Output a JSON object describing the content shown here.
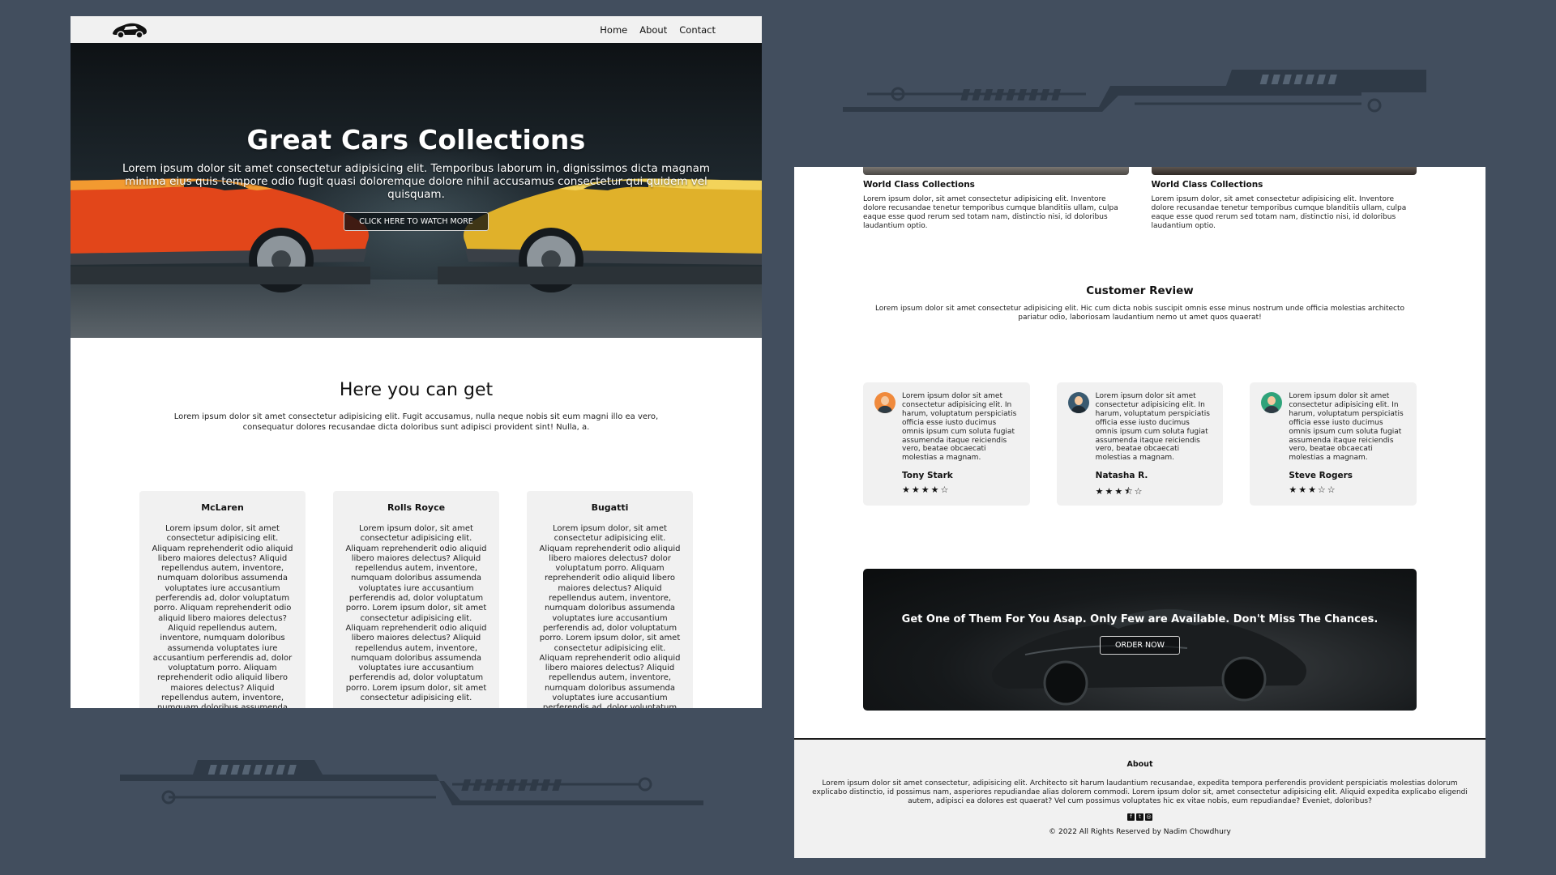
{
  "nav": {
    "links": [
      "Home",
      "About",
      "Contact"
    ]
  },
  "hero": {
    "title": "Great Cars Collections",
    "text": "Lorem ipsum dolor sit amet consectetur adipisicing elit. Temporibus laborum in, dignissimos dicta magnam minima eius quis tempore odio fugit quasi doloremque dolore nihil accusamus consectetur qui quidem vel quisquam.",
    "button": "CLICK HERE TO WATCH MORE"
  },
  "get": {
    "title": "Here you can get",
    "text": "Lorem ipsum dolor sit amet consectetur adipisicing elit. Fugit accusamus, nulla neque nobis sit eum magni illo ea vero, consequatur dolores recusandae dicta doloribus sunt adipisci provident sint! Nulla, a."
  },
  "brands": [
    {
      "name": "McLaren",
      "text": "Lorem ipsum dolor, sit amet consectetur adipisicing elit. Aliquam reprehenderit odio aliquid libero maiores delectus? Aliquid repellendus autem, inventore, numquam doloribus assumenda voluptates iure accusantium perferendis ad, dolor voluptatum porro. Aliquam reprehenderit odio aliquid libero maiores delectus? Aliquid repellendus autem, inventore, numquam doloribus assumenda voluptates iure accusantium perferendis ad, dolor voluptatum porro. Aliquam reprehenderit odio aliquid libero maiores delectus? Aliquid repellendus autem, inventore, numquam doloribus assumenda voluptates iure accusantium perferendis ad, dolor"
    },
    {
      "name": "Rolls Royce",
      "text": "Lorem ipsum dolor, sit amet consectetur adipisicing elit. Aliquam reprehenderit odio aliquid libero maiores delectus? Aliquid repellendus autem, inventore, numquam doloribus assumenda voluptates iure accusantium perferendis ad, dolor voluptatum porro. Lorem ipsum dolor, sit amet consectetur adipisicing elit. Aliquam reprehenderit odio aliquid libero maiores delectus? Aliquid repellendus autem, inventore, numquam doloribus assumenda voluptates iure accusantium perferendis ad, dolor voluptatum porro. Lorem ipsum dolor, sit amet consectetur adipisicing elit."
    },
    {
      "name": "Bugatti",
      "text": "Lorem ipsum dolor, sit amet consectetur adipisicing elit. Aliquam reprehenderit odio aliquid libero maiores delectus? dolor voluptatum porro. Aliquam reprehenderit odio aliquid libero maiores delectus? Aliquid repellendus autem, inventore, numquam doloribus assumenda voluptates iure accusantium perferendis ad, dolor voluptatum porro. Lorem ipsum dolor, sit amet consectetur adipisicing elit. Aliquam reprehenderit odio aliquid libero maiores delectus? Aliquid repellendus autem, inventore, numquam doloribus assumenda voluptates iure accusantium perferendis ad, dolor voluptatum porro."
    }
  ],
  "world": [
    {
      "title": "World Class Collections",
      "text": "Lorem ipsum dolor, sit amet consectetur adipisicing elit. Inventore dolore recusandae tenetur temporibus cumque blanditiis ullam, culpa eaque esse quod rerum sed totam nam, distinctio nisi, id doloribus laudantium optio."
    },
    {
      "title": "World Class Collections",
      "text": "Lorem ipsum dolor, sit amet consectetur adipisicing elit. Inventore dolore recusandae tenetur temporibus cumque blanditiis ullam, culpa eaque esse quod rerum sed totam nam, distinctio nisi, id doloribus laudantium optio."
    }
  ],
  "review": {
    "title": "Customer Review",
    "text": "Lorem ipsum dolor sit amet consectetur adipisicing elit. Hic cum dicta nobis suscipit omnis esse minus nostrum unde officia molestias architecto pariatur odio, laboriosam laudantium nemo ut amet quos quaerat!"
  },
  "reviews": [
    {
      "quote": "Lorem ipsum dolor sit amet consectetur adipisicing elit. In harum, voluptatum perspiciatis officia esse iusto ducimus omnis ipsum cum soluta fugiat assumenda itaque reiciendis vero, beatae obcaecati molestias a magnam.",
      "name": "Tony Stark",
      "stars": "★★★★☆",
      "rating": 4,
      "avatar_color": "#f08a3c"
    },
    {
      "quote": "Lorem ipsum dolor sit amet consectetur adipisicing elit. In harum, voluptatum perspiciatis officia esse iusto ducimus omnis ipsum cum soluta fugiat assumenda itaque reiciendis vero, beatae obcaecati molestias a magnam.",
      "name": "Natasha R.",
      "stars": "★★★⯪☆",
      "rating": 3.5,
      "avatar_color": "#3a5a70"
    },
    {
      "quote": "Lorem ipsum dolor sit amet consectetur adipisicing elit. In harum, voluptatum perspiciatis officia esse iusto ducimus omnis ipsum cum soluta fugiat assumenda itaque reiciendis vero, beatae obcaecati molestias a magnam.",
      "name": "Steve Rogers",
      "stars": "★★★☆☆",
      "rating": 3,
      "avatar_color": "#2fa37a"
    }
  ],
  "banner": {
    "text": "Get One of Them For You Asap. Only Few are Available. Don't Miss The Chances.",
    "button": "ORDER NOW"
  },
  "footer": {
    "title": "About",
    "text": "Lorem ipsum dolor sit amet consectetur, adipisicing elit. Architecto sit harum laudantium recusandae, expedita tempora perferendis provident perspiciatis molestias dolorum explicabo distinctio, id possimus nam, asperiores repudiandae alias dolorem commodi. Lorem ipsum dolor sit, amet consectetur adipisicing elit. Aliquid expedita explicabo eligendi autem, adipisci ea dolores est quaerat? Vel cum possimus voluptates hic ex vitae nobis, eum repudiandae? Eveniet, doloribus?",
    "socials": [
      "facebook-icon",
      "twitter-icon",
      "instagram-icon"
    ],
    "copyright": "© 2022 All Rights Reserved by Nadim Chowdhury"
  },
  "colors": {
    "background": "#424e5e",
    "card": "#f1f1f1"
  }
}
